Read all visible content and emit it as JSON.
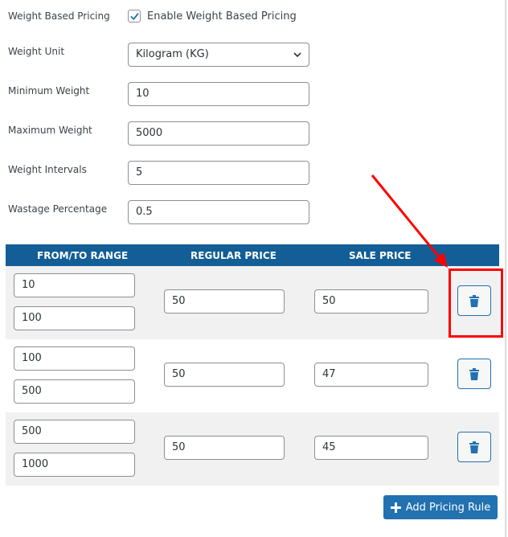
{
  "settings": {
    "weight_based_pricing": {
      "label": "Weight Based Pricing",
      "checkbox_label": "Enable Weight Based Pricing",
      "checked": true
    },
    "weight_unit": {
      "label": "Weight Unit",
      "value": "Kilogram (KG)"
    },
    "minimum_weight": {
      "label": "Minimum Weight",
      "value": "10"
    },
    "maximum_weight": {
      "label": "Maximum Weight",
      "value": "5000"
    },
    "weight_intervals": {
      "label": "Weight Intervals",
      "value": "5"
    },
    "wastage_percentage": {
      "label": "Wastage Percentage",
      "value": "0.5"
    }
  },
  "table": {
    "headers": [
      "FROM/TO RANGE",
      "REGULAR PRICE",
      "SALE PRICE"
    ],
    "rows": [
      {
        "from": "10",
        "to": "100",
        "regular_price": "50",
        "sale_price": "50"
      },
      {
        "from": "100",
        "to": "500",
        "regular_price": "50",
        "sale_price": "47"
      },
      {
        "from": "500",
        "to": "1000",
        "regular_price": "50",
        "sale_price": "45"
      }
    ],
    "delete_icon": "trash-icon"
  },
  "add_rule_button": {
    "label": "Add Pricing Rule",
    "icon": "plus-icon"
  },
  "annotation": {
    "type": "red-arrow-and-box",
    "target": "delete-button-row-1",
    "color": "#ff0000"
  },
  "colors": {
    "header_bg": "#135e96",
    "primary": "#2271b1",
    "row_shade": "#f1f1f1",
    "annotation": "#ff0000"
  }
}
